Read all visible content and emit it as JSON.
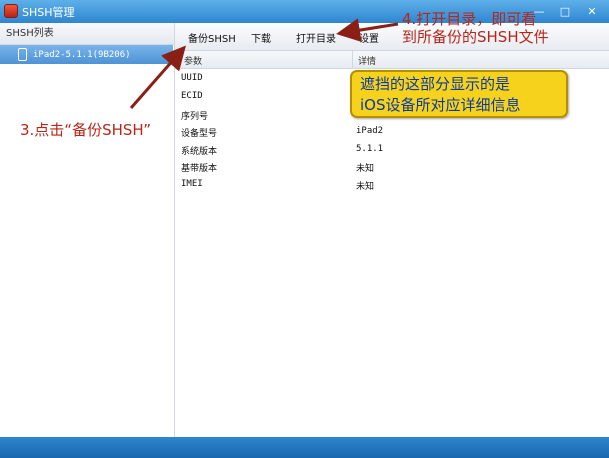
{
  "window": {
    "title": "SHSH管理",
    "controls": [
      "—",
      "□",
      "✕"
    ]
  },
  "sidebar": {
    "header": "SHSH列表",
    "items": [
      {
        "label": "iPad2-5.1.1(9B206)",
        "icon": "ipad-icon",
        "selected": true
      }
    ]
  },
  "toolbar": {
    "backup_label": "备份SHSH",
    "download_label": "下载",
    "open_dir_label": "打开目录",
    "settings_label": "设置"
  },
  "table": {
    "columns": [
      "参数",
      "详情"
    ],
    "rows": [
      {
        "key": "UUID",
        "value": ""
      },
      {
        "key": "ECID",
        "value": ""
      },
      {
        "key": "序列号",
        "value": ""
      },
      {
        "key": "设备型号",
        "value": "iPad2"
      },
      {
        "key": "系统版本",
        "value": "5.1.1"
      },
      {
        "key": "基带版本",
        "value": "未知"
      },
      {
        "key": "IMEI",
        "value": "未知"
      }
    ]
  },
  "annotations": {
    "step3": "3.点击“备份SHSH”",
    "step4_line1": "4.打开目录，即可看",
    "step4_line2": "到所备份的SHSH文件",
    "note_line1": "遮挡的这部分显示的是",
    "note_line2": "iOS设备所对应详细信息",
    "colors": {
      "annotation": "#b8261a",
      "note_bg": "#f6d21c",
      "note_text": "#0a3aa0"
    }
  }
}
